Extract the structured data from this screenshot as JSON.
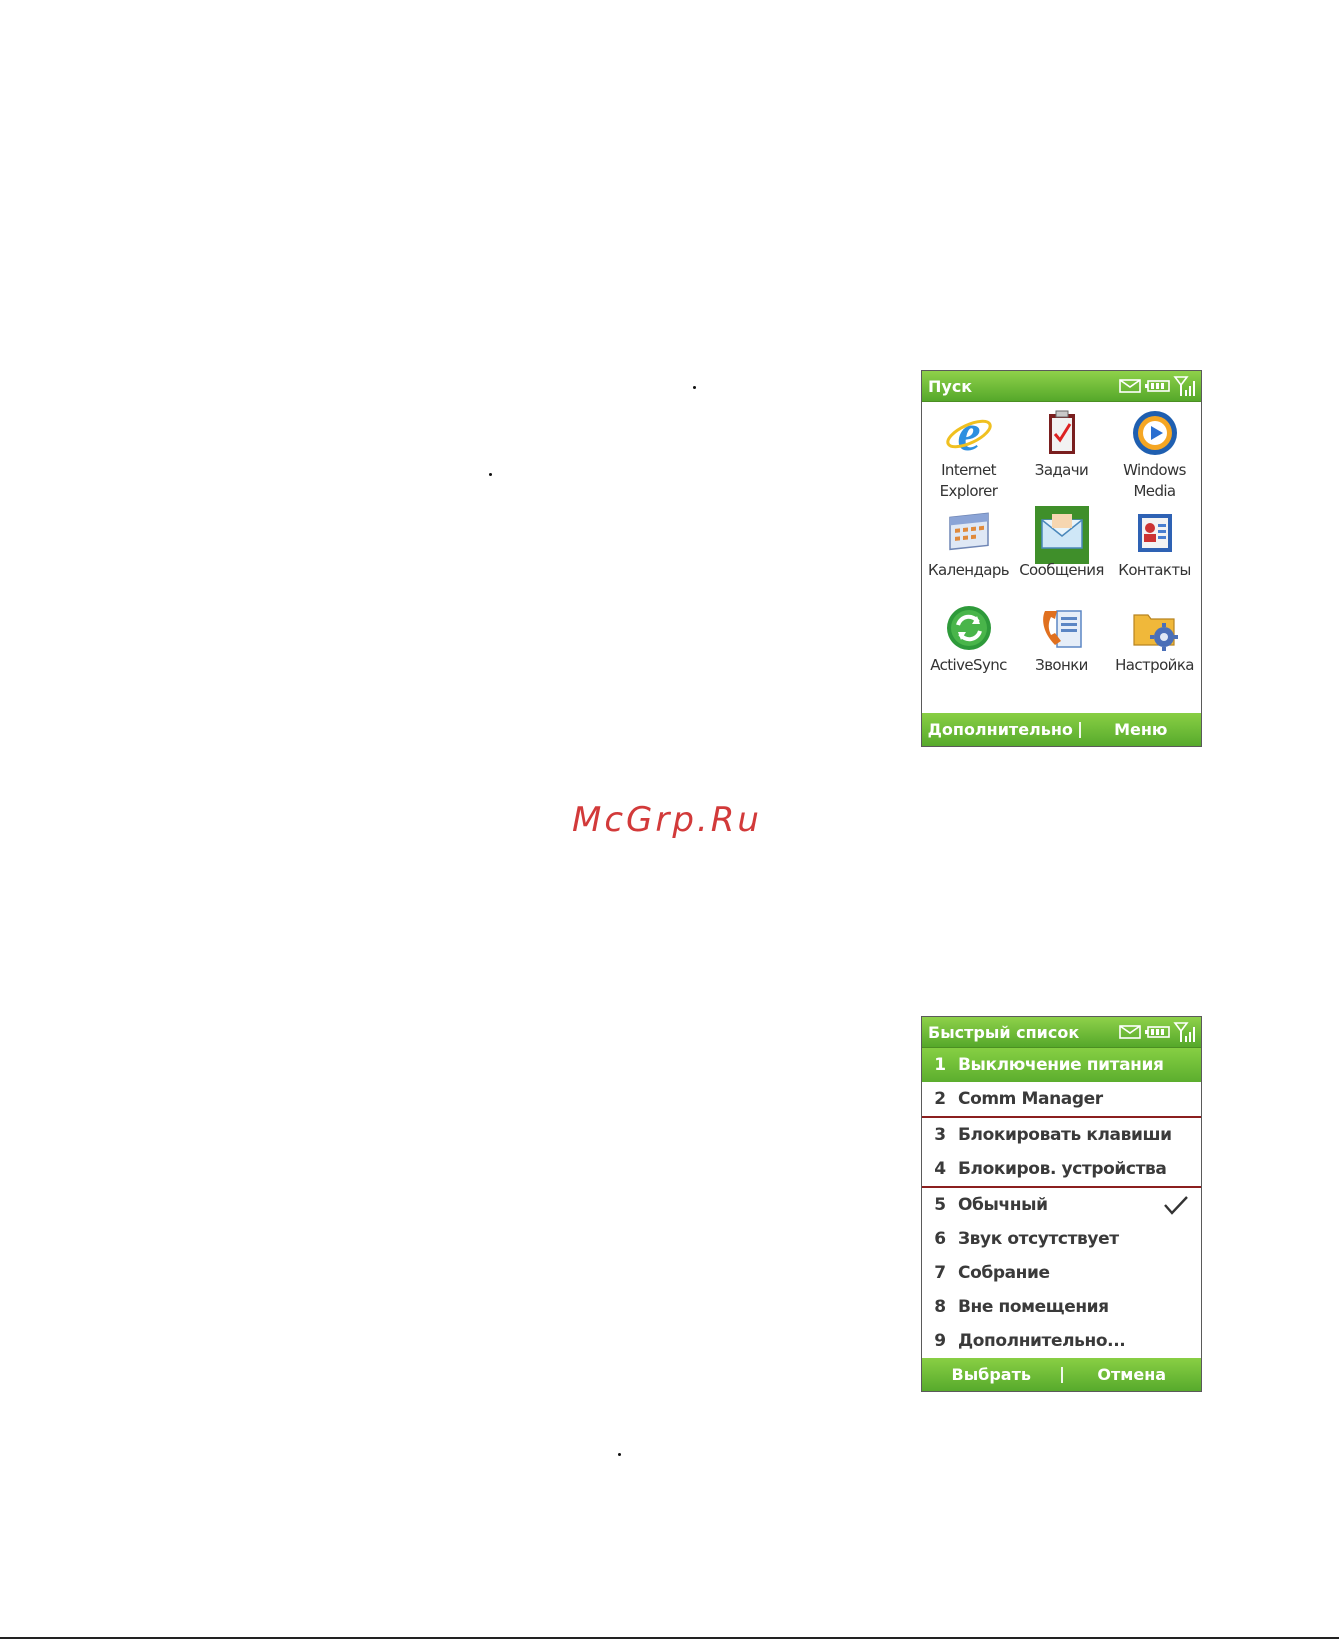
{
  "start_screen": {
    "title": "Пуск",
    "apps": [
      {
        "label": "Internet Explorer",
        "icon": "internet-explorer-icon"
      },
      {
        "label": "Задачи",
        "icon": "tasks-icon"
      },
      {
        "label": "Windows Media",
        "icon": "windows-media-icon"
      },
      {
        "label": "Календарь",
        "icon": "calendar-icon"
      },
      {
        "label": "Сообщения",
        "icon": "messages-icon"
      },
      {
        "label": "Контакты",
        "icon": "contacts-icon"
      },
      {
        "label": "ActiveSync",
        "icon": "activesync-icon"
      },
      {
        "label": "Звонки",
        "icon": "calls-icon"
      },
      {
        "label": "Настройка",
        "icon": "settings-icon"
      }
    ],
    "left_softkey": "Дополнительно",
    "right_softkey": "Меню"
  },
  "watermark": "McGrp.Ru",
  "quick_list_screen": {
    "title": "Быстрый список",
    "items": [
      {
        "num": "1",
        "label": "Выключение питания"
      },
      {
        "num": "2",
        "label": "Comm Manager"
      },
      {
        "num": "3",
        "label": "Блокировать клавиши"
      },
      {
        "num": "4",
        "label": "Блокиров. устройства"
      },
      {
        "num": "5",
        "label": "Обычный"
      },
      {
        "num": "6",
        "label": "Звук отсутствует"
      },
      {
        "num": "7",
        "label": "Собрание"
      },
      {
        "num": "8",
        "label": "Вне помещения"
      },
      {
        "num": "9",
        "label": "Дополнительно..."
      }
    ],
    "left_softkey": "Выбрать",
    "right_softkey": "Отмена"
  },
  "colors": {
    "accent_green": "#66b534",
    "watermark_red": "#d23a3a",
    "divider_red": "#8b1f1f"
  }
}
